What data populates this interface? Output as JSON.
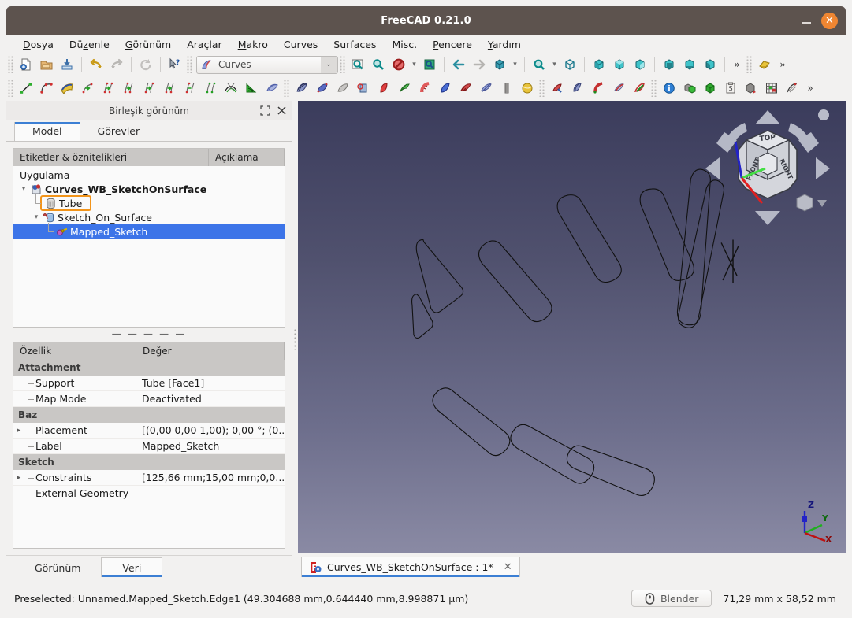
{
  "window": {
    "title": "FreeCAD 0.21.0",
    "minimize_label": "–",
    "close_label": "✕",
    "accent_close": "#ef8632",
    "titlebar_bg": "#5d534e"
  },
  "menubar": {
    "items": [
      {
        "label": "Dosya",
        "mnemonic": "D"
      },
      {
        "label": "Düzenle",
        "mnemonic": "z"
      },
      {
        "label": "Görünüm",
        "mnemonic": "G"
      },
      {
        "label": "Araçlar",
        "mnemonic": ""
      },
      {
        "label": "Makro",
        "mnemonic": "M"
      },
      {
        "label": "Curves",
        "mnemonic": ""
      },
      {
        "label": "Surfaces",
        "mnemonic": ""
      },
      {
        "label": "Misc.",
        "mnemonic": ""
      },
      {
        "label": "Pencere",
        "mnemonic": "P"
      },
      {
        "label": "Yardım",
        "mnemonic": "Y"
      }
    ]
  },
  "toolbar_file": {
    "buttons": [
      {
        "name": "new-document-icon",
        "title": "New"
      },
      {
        "name": "open-document-icon",
        "title": "Open"
      },
      {
        "name": "save-document-icon",
        "title": "Save"
      },
      {
        "name": "undo-icon",
        "title": "Undo"
      },
      {
        "name": "redo-icon",
        "title": "Redo"
      },
      {
        "name": "refresh-icon",
        "title": "Refresh"
      },
      {
        "name": "whats-this-icon",
        "title": "What's this?"
      }
    ]
  },
  "workbench_selector": {
    "value": "Curves",
    "icon": "curves-workbench-icon",
    "caret": "⌄"
  },
  "toolbar_view": {
    "buttons": [
      {
        "name": "fit-all-icon"
      },
      {
        "name": "fit-selection-icon"
      },
      {
        "name": "draw-style-icon",
        "has_arrow": true
      },
      {
        "name": "axonometric-view-icon"
      },
      {
        "name": "back-navigation-icon"
      },
      {
        "name": "forward-navigation-icon"
      },
      {
        "name": "isometric-view-icon",
        "has_arrow": true
      },
      {
        "name": "zoom-box-icon",
        "has_arrow": true
      },
      {
        "name": "axonometric-cube-icon"
      },
      {
        "name": "front-view-icon"
      },
      {
        "name": "top-view-icon"
      },
      {
        "name": "right-view-icon"
      },
      {
        "name": "rear-view-icon"
      },
      {
        "name": "bottom-view-icon"
      },
      {
        "name": "left-view-icon"
      }
    ],
    "overflow_label": "»",
    "appearance_icon": "appearance-icon",
    "overflow2_label": "»"
  },
  "toolbar_curves": {
    "buttons": [
      {
        "name": "line-curve-icon"
      },
      {
        "name": "bezier-curve-icon"
      },
      {
        "name": "editable-spline-icon"
      },
      {
        "name": "join-curve-icon"
      },
      {
        "name": "split-curve-icon"
      },
      {
        "name": "discretize-curve-icon"
      },
      {
        "name": "approximate-curve-icon"
      },
      {
        "name": "interpolate-curve-icon"
      },
      {
        "name": "extend-curve-icon"
      },
      {
        "name": "blend-curve-icon"
      },
      {
        "name": "comb-plot-icon"
      },
      {
        "name": "zebra-surface-icon"
      },
      {
        "name": "isocurve-icon"
      },
      {
        "name": "sketch-on-surface-icon"
      },
      {
        "name": "gordon-surface-icon"
      },
      {
        "name": "surface-patch-icon"
      },
      {
        "name": "profile-support-icon"
      },
      {
        "name": "ruled-surface-icon"
      },
      {
        "name": "sweep-surface-icon"
      },
      {
        "name": "pipeshell-icon"
      },
      {
        "name": "loft-surface-icon"
      },
      {
        "name": "segment-surface-icon"
      },
      {
        "name": "flatten-face-icon"
      },
      {
        "name": "multi-loft-icon"
      },
      {
        "name": "sphere-map-icon"
      },
      {
        "name": "paste-geometry-icon"
      },
      {
        "name": "solid-from-shell-icon"
      },
      {
        "name": "curve-on-mesh-icon"
      },
      {
        "name": "mixed-curve-icon"
      },
      {
        "name": "sublink-icon"
      },
      {
        "name": "trim-face-icon"
      },
      {
        "name": "info-icon"
      },
      {
        "name": "extract-compound-icon"
      },
      {
        "name": "solid-box-icon"
      },
      {
        "name": "clipboard-macro-icon"
      },
      {
        "name": "reverse-direction-icon"
      },
      {
        "name": "grid-icon"
      },
      {
        "name": "nurbs-editor-icon"
      }
    ],
    "overflow_label": "»"
  },
  "combo_view": {
    "header_title": "Birleşik görünüm",
    "float_icon": "expand-panel-icon",
    "close_icon": "close-panel-icon",
    "tabs": [
      {
        "label": "Model",
        "active": true
      },
      {
        "label": "Görevler",
        "active": false
      }
    ],
    "tree": {
      "columns": [
        "Etiketler & öznitelikleri",
        "Açıklama"
      ],
      "rows": [
        {
          "label": "Uygulama",
          "depth": 0,
          "icon": "",
          "bold": false,
          "selected": false,
          "highlighted": false,
          "twisty": ""
        },
        {
          "label": "Curves_WB_SketchOnSurface",
          "depth": 1,
          "icon": "document-icon",
          "bold": true,
          "selected": false,
          "highlighted": false,
          "twisty": "⌄"
        },
        {
          "label": "Tube",
          "depth": 2,
          "icon": "tube-icon",
          "bold": false,
          "selected": false,
          "highlighted": true,
          "twisty": ""
        },
        {
          "label": "Sketch_On_Surface",
          "depth": 2,
          "icon": "sketch-on-surface-tree-icon",
          "bold": false,
          "selected": false,
          "highlighted": false,
          "twisty": "⌄"
        },
        {
          "label": "Mapped_Sketch",
          "depth": 3,
          "icon": "mapped-sketch-icon",
          "bold": false,
          "selected": true,
          "highlighted": false,
          "twisty": ""
        }
      ],
      "highlight_color": "#f2941a",
      "selection_color": "#3c74e8"
    },
    "splitter_glyph": "— — — — —",
    "properties": {
      "columns": [
        "Özellik",
        "Değer"
      ],
      "groups": [
        {
          "name": "Attachment",
          "rows": [
            {
              "name": "Support",
              "value": "Tube [Face1]",
              "expandable": false
            },
            {
              "name": "Map Mode",
              "value": "Deactivated",
              "expandable": false,
              "last": true
            }
          ]
        },
        {
          "name": "Baz",
          "rows": [
            {
              "name": "Placement",
              "value": "[(0,00 0,00 1,00); 0,00 °; (0...",
              "expandable": true
            },
            {
              "name": "Label",
              "value": "Mapped_Sketch",
              "expandable": false,
              "last": true
            }
          ]
        },
        {
          "name": "Sketch",
          "rows": [
            {
              "name": "Constraints",
              "value": "[125,66 mm;15,00 mm;0,0...",
              "expandable": true
            },
            {
              "name": "External Geometry",
              "value": "",
              "expandable": false,
              "last": true
            }
          ]
        }
      ]
    },
    "bottom_tabs": [
      {
        "label": "Görünüm",
        "active": false
      },
      {
        "label": "Veri",
        "active": true
      }
    ]
  },
  "viewport": {
    "background_top": "#3b3c5c",
    "background_bottom": "#8a8aa4",
    "navcube": {
      "faces": [
        "TOP",
        "FRONT",
        "RIGHT"
      ],
      "arrow_up": "arrow-up-icon",
      "arrow_down": "arrow-down-icon",
      "arrow_left": "arrow-left-icon",
      "arrow_right": "arrow-right-icon",
      "rotate_left": "rotate-left-icon",
      "rotate_right": "rotate-right-icon",
      "corner_dot": "home-dot-icon",
      "view_menu": "view-menu-icon"
    },
    "axis_indicator": {
      "x_label": "X",
      "x_color": "#b40000",
      "y_label": "Y",
      "y_color": "#00b000",
      "z_label": "Z",
      "z_color": "#1a1ab4"
    }
  },
  "doc_tabs": [
    {
      "label": "Curves_WB_SketchOnSurface : 1*",
      "icon": "freecad-doc-icon",
      "close": "✕",
      "active": true
    }
  ],
  "statusbar": {
    "message": "Preselected: Unnamed.Mapped_Sketch.Edge1 (49.304688 mm,0.644440 mm,8.998871 µm)",
    "button_label": "Blender",
    "button_icon": "mouse-navigation-icon",
    "dimensions": "71,29 mm x 58,52 mm"
  }
}
